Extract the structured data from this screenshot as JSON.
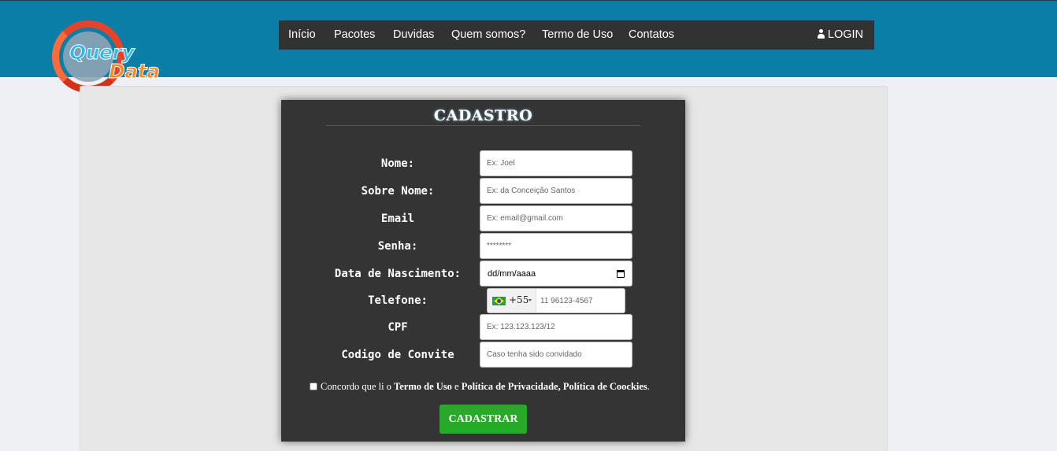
{
  "brand": {
    "line1": "Query",
    "line2": "Data"
  },
  "nav": {
    "items": [
      "Início",
      "Pacotes",
      "Duvidas",
      "Quem somos?",
      "Termo de Uso",
      "Contatos"
    ],
    "login": "LOGIN"
  },
  "form": {
    "title": "CADASTRO",
    "fields": {
      "nome": {
        "label": "Nome:",
        "placeholder": "Ex: Joel"
      },
      "sobrenome": {
        "label": "Sobre Nome:",
        "placeholder": "Ex: da Conceição Santos"
      },
      "email": {
        "label": "Email",
        "placeholder": "Ex: email@gmail.com"
      },
      "senha": {
        "label": "Senha:",
        "placeholder": "********"
      },
      "nascimento": {
        "label": "Data de Nascimento:",
        "value": "dd/mm/aaaa"
      },
      "telefone": {
        "label": "Telefone:",
        "country_code": "+55",
        "placeholder": "11 96123-4567"
      },
      "cpf": {
        "label": "CPF",
        "placeholder": "Ex: 123.123.123/12"
      },
      "convite": {
        "label": "Codigo de Convite",
        "placeholder": "Caso tenha sido convidado"
      }
    },
    "agree": {
      "prefix": "Concordo que li o ",
      "terms": "Termo de Uso",
      "and": " e ",
      "privacy": "Política de Privacidade,",
      "cookies": "Política de Coockies",
      "suffix": "."
    },
    "submit": "CADASTRAR"
  },
  "colors": {
    "header": "#0b7ea8",
    "nav": "#323232",
    "card": "#343434",
    "submit": "#28a92a"
  }
}
